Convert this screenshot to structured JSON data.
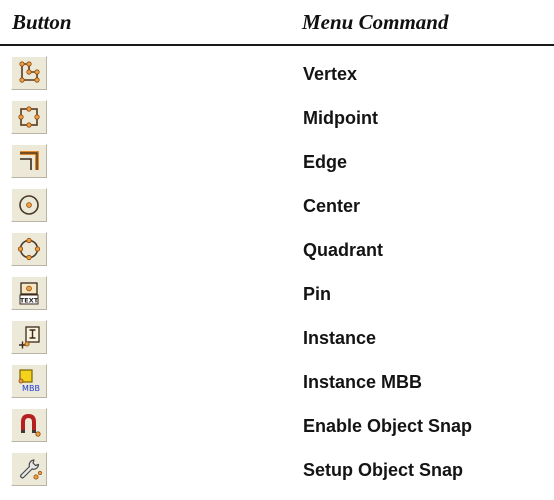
{
  "header": {
    "button_col": "Button",
    "command_col": "Menu Command"
  },
  "rows": [
    {
      "icon": "vertex-snap-icon",
      "label": "Vertex"
    },
    {
      "icon": "midpoint-snap-icon",
      "label": "Midpoint"
    },
    {
      "icon": "edge-snap-icon",
      "label": "Edge"
    },
    {
      "icon": "center-snap-icon",
      "label": "Center"
    },
    {
      "icon": "quadrant-snap-icon",
      "label": "Quadrant"
    },
    {
      "icon": "pin-snap-icon",
      "label": "Pin",
      "icon_text": "TEXT"
    },
    {
      "icon": "instance-snap-icon",
      "label": "Instance"
    },
    {
      "icon": "instance-mbb-snap-icon",
      "label": "Instance MBB",
      "icon_text": "MBB"
    },
    {
      "icon": "magnet-icon",
      "label": "Enable Object Snap"
    },
    {
      "icon": "wrench-icon",
      "label": "Setup Object Snap"
    }
  ],
  "colors": {
    "button_face": "#ece9d8",
    "icon_orange": "#d9822b",
    "icon_dark": "#4a3a2a",
    "mbb_blue": "#1c3fd1",
    "magnet_red": "#b51f1f"
  }
}
